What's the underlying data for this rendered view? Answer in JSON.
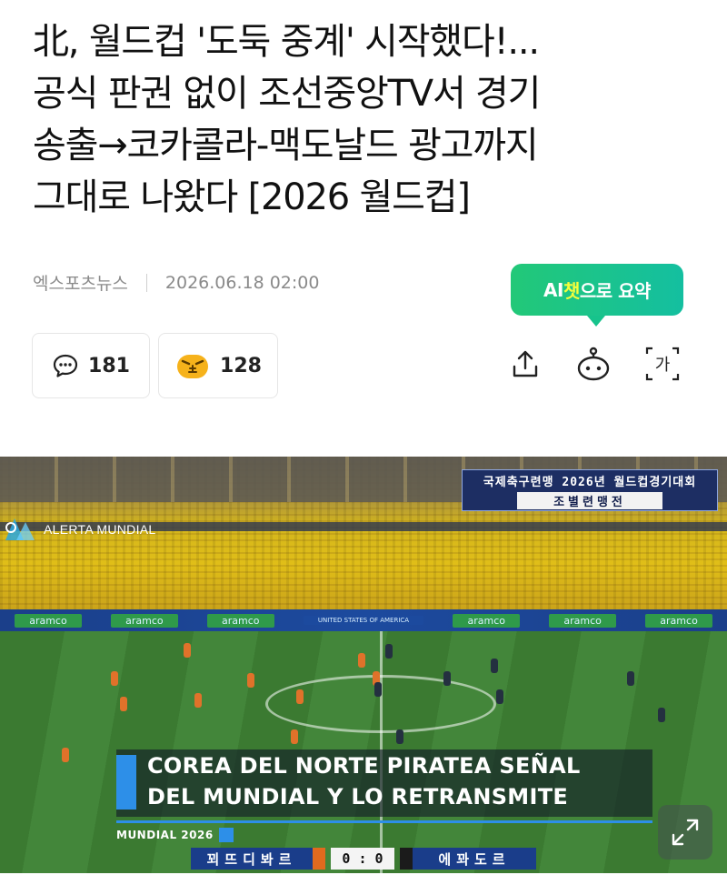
{
  "article": {
    "headline_lines": [
      "北, 월드컵 '도둑 중계' 시작했다!...",
      "공식 판권 없이 조선중앙TV서 경기",
      "송출→코카콜라-맥도날드 광고까지",
      "그대로 나왔다 [2026 월드컵]"
    ],
    "source": "엑스포츠뉴스",
    "datetime": "2026.06.18 02:00"
  },
  "ai_summary": {
    "label_ai": "AI",
    "label_highlight": "챗",
    "label_rest": "으로 요약"
  },
  "reactions": {
    "comments_count": "181",
    "angry_count": "128"
  },
  "toolbar": {
    "share_icon": "share-icon",
    "bot_icon": "chatbot-icon",
    "font_icon_text": "가"
  },
  "video": {
    "stadium_board_line1": "국제축구련맹 2026년 월드컵경기대회",
    "stadium_board_line2": "조별련맹전",
    "channel_logo_text": "ALERTA MUNDIAL",
    "ad_board_items": [
      "aramco",
      "aramco",
      "aramco",
      "UNITED STATES OF AMERICA",
      "aramco",
      "aramco",
      "aramco"
    ],
    "caption_line1": "COREA DEL NORTE PIRATEA SEÑAL",
    "caption_line2": "DEL MUNDIAL Y LO RETRANSMITE",
    "caption_tag": "MUNDIAL 2026",
    "team_a": "꾀뜨디봐르",
    "score": "0 : 0",
    "team_b": "에꽈도르",
    "accent_blue": "#2d8fe8",
    "team_a_color": "#e06a1e",
    "team_b_color": "#1b1b1b"
  }
}
